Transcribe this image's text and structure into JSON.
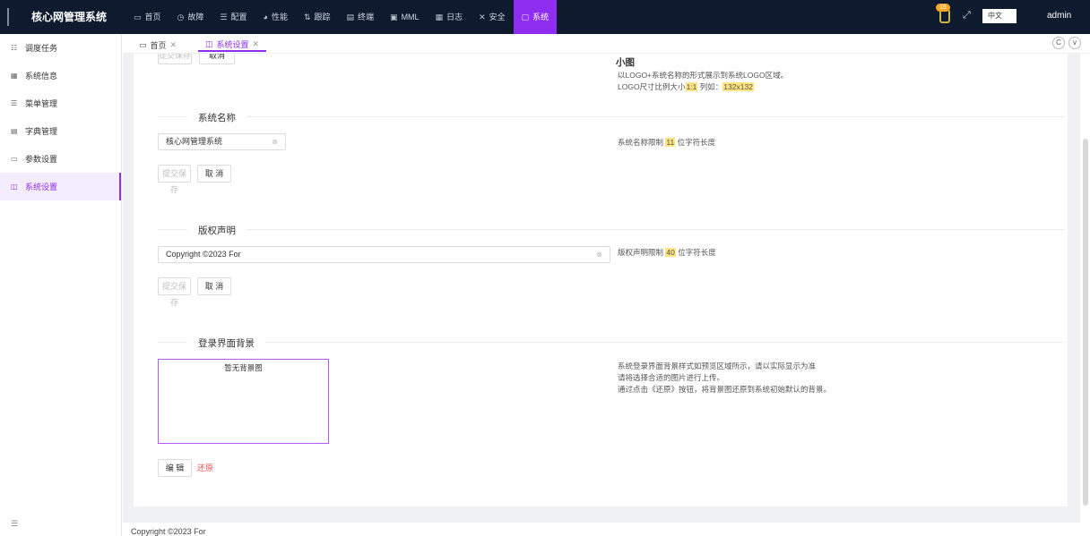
{
  "topbar": {
    "app_title": "核心网管理系统",
    "nav": [
      {
        "icon": "▭",
        "label": "首页"
      },
      {
        "icon": "◷",
        "label": "故障"
      },
      {
        "icon": "☰",
        "label": "配置"
      },
      {
        "icon": "◕",
        "label": "性能"
      },
      {
        "icon": "⇅",
        "label": "跟踪"
      },
      {
        "icon": "▤",
        "label": "终端"
      },
      {
        "icon": "▣",
        "label": "MML"
      },
      {
        "icon": "▦",
        "label": "日志"
      },
      {
        "icon": "✕",
        "label": "安全"
      },
      {
        "icon": "▢",
        "label": "系统"
      }
    ],
    "notification_count": "15",
    "language": "中文",
    "user": "admin"
  },
  "sidebar": {
    "items": [
      {
        "icon": "☷",
        "label": "调度任务"
      },
      {
        "icon": "▦",
        "label": "系统信息"
      },
      {
        "icon": "☰",
        "label": "菜单管理"
      },
      {
        "icon": "▤",
        "label": "字典管理"
      },
      {
        "icon": "▭",
        "label": "参数设置"
      },
      {
        "icon": "◫",
        "label": "系统设置"
      }
    ],
    "collapse_icon": "☰"
  },
  "tabs": [
    {
      "icon": "▭",
      "label": "首页",
      "close": "✕"
    },
    {
      "icon": "◫",
      "label": "系统设置",
      "close": "✕"
    }
  ],
  "tab_buttons": {
    "refresh": "C",
    "more": "v"
  },
  "top_partial": {
    "submit": "提交保存",
    "cancel": "取消",
    "small_title": "小图",
    "hint_line1": "以LOGO+系统名称的形式展示到系统LOGO区域。",
    "hint_line2_a": "LOGO尺寸比例大小",
    "hint_line2_ratio": "1:1",
    "hint_line2_b": " 列如：",
    "hint_line2_size": "132x132"
  },
  "system_name": {
    "title": "系统名称",
    "value": "核心网管理系统",
    "clear": "⊗",
    "hint_a": "系统名称限制 ",
    "hint_num": "11",
    "hint_b": " 位字符长度",
    "submit": "提交保存",
    "cancel": "取 消"
  },
  "copyright": {
    "title": "版权声明",
    "value": "Copyright ©2023 For",
    "clear": "⊗",
    "hint_a": "版权声明限制 ",
    "hint_num": "40",
    "hint_b": " 位字符长度",
    "submit": "提交保存",
    "cancel": "取 消"
  },
  "login_bg": {
    "title": "登录界面背景",
    "no_bg": "暂无背景图",
    "hint1": "系统登录界面背景样式如预览区域所示，请以实际显示为准",
    "hint2": "请将选择合适的图片进行上传。",
    "hint3": "通过点击《还原》按钮，将背景图还原到系统初始默认的背景。",
    "edit": "编 辑",
    "restore": "还原"
  },
  "footer": "Copyright ©2023 For"
}
